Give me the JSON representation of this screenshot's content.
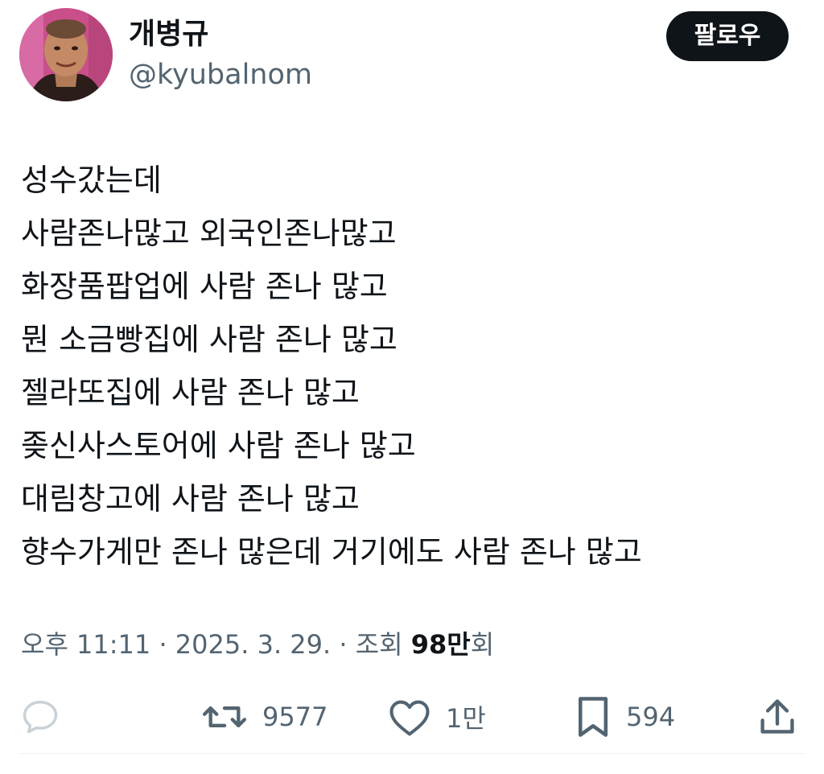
{
  "user": {
    "display_name": "개병규",
    "handle": "@kyubalnom",
    "avatar_icon": "profile-photo"
  },
  "follow_button": {
    "label": "팔로우"
  },
  "tweet": {
    "lines": [
      "성수갔는데",
      "사람존나많고 외국인존나많고",
      "화장품팝업에 사람 존나 많고",
      "뭔 소금빵집에 사람 존나 많고",
      "젤라또집에 사람 존나 많고",
      "좆신사스토어에 사람 존나 많고",
      "대림창고에 사람 존나 많고",
      "향수가게만 존나 많은데 거기에도 사람 존나 많고"
    ]
  },
  "meta": {
    "time": "오후 11:11",
    "separator": " · ",
    "date": "2025. 3. 29.",
    "views_label": "조회 ",
    "views_count": "98만",
    "views_suffix": "회"
  },
  "actions": {
    "reply": {
      "icon": "reply-icon",
      "count": ""
    },
    "retweet": {
      "icon": "retweet-icon",
      "count": "9577"
    },
    "like": {
      "icon": "heart-icon",
      "count": "1만"
    },
    "bookmark": {
      "icon": "bookmark-icon",
      "count": "594"
    },
    "share": {
      "icon": "share-icon",
      "count": ""
    }
  },
  "colors": {
    "text_primary": "#0f1419",
    "text_secondary": "#536471",
    "icon_muted": "#c9d1d6",
    "button_bg": "#0f1419",
    "button_text": "#ffffff"
  }
}
